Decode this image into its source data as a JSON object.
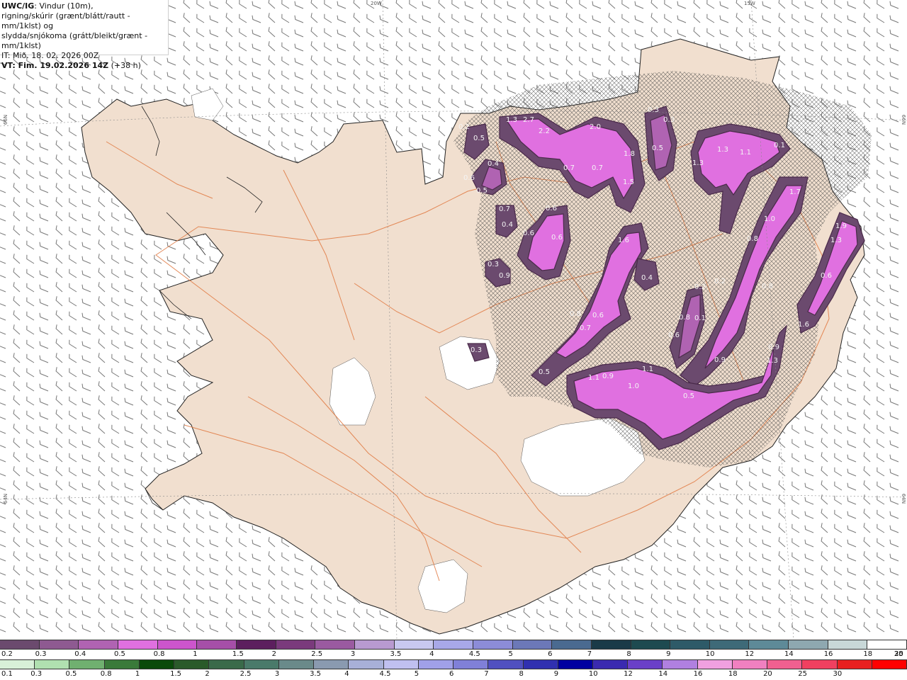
{
  "title": {
    "model": "UWC/IG",
    "line1": ": Vindur (10m),",
    "line2": "rigning/skúrir (grænt/blátt/rautt - mm/1klst) og",
    "line3": "slydda/snjókoma (grátt/bleikt/grænt - mm/1klst)",
    "it": "IT: Mið. 18. 02. 2026 00Z",
    "vt_bold": "VT: Fim. 19.02.2026 14Z",
    "vt_lead": " (+38 h)"
  },
  "grid_labels": {
    "lon_20w": "20W",
    "lon_15w": "15W",
    "lat_66n_left": "66N",
    "lat_66n_right": "66N",
    "lat_64n_left": "64N",
    "lat_64n_right": "64N"
  },
  "map_labels": [
    "1.3",
    "2.7",
    "2.2",
    "2.0",
    "0.3",
    "0.3",
    "0.2",
    "0.5",
    "1.8",
    "0.5",
    "1.3",
    "1.1",
    "0.1",
    "1.3",
    "0.7",
    "0.7",
    "1.5",
    "0.6",
    "1.7",
    "0.4",
    "0.5",
    "0.7",
    "0.6",
    "1.0",
    "1.9",
    "0.4",
    "0.6",
    "0.6",
    "1.6",
    "1.3",
    "0.8",
    "0.3",
    "0.9",
    "0.4",
    "0.2",
    "0.2",
    "0.8",
    "0.8",
    "0.6",
    "0.8",
    "0.6",
    "0.1",
    "0.7",
    "0.6",
    "1.6",
    "0.3",
    "0.9",
    "0.5",
    "1.1",
    "0.9",
    "1.1",
    "0.9",
    "1.3",
    "1.0",
    "0.5"
  ],
  "legend_snow": {
    "colors": [
      "#6b4a6e",
      "#8e5a91",
      "#b063b2",
      "#e070e0",
      "#cc55cc",
      "#a64fa8",
      "#5c1f5e",
      "#7a3a7c",
      "#9a5aa0",
      "#b89ad0",
      "#c8c8f0",
      "#a8a8e8",
      "#8c8cd8",
      "#6c78b8",
      "#4a6a90",
      "#1a3a48",
      "#1e4a50",
      "#2e5a68",
      "#3e6a78",
      "#5e8a98",
      "#8ea8b0",
      "#c8d8d8",
      "#ffffff"
    ],
    "labels": [
      "0.2",
      "0.3",
      "0.4",
      "0.5",
      "0.8",
      "1",
      "1.5",
      "2",
      "2.5",
      "3",
      "3.5",
      "4",
      "4.5",
      "5",
      "6",
      "7",
      "8",
      "9",
      "10",
      "12",
      "14",
      "16",
      "18",
      "20",
      "25",
      "30"
    ]
  },
  "legend_rain": {
    "colors": [
      "#d8f0d8",
      "#b0e0b0",
      "#70b070",
      "#3a7a3a",
      "#0a4a0a",
      "#2a5a2a",
      "#3a6a4a",
      "#4a7a6a",
      "#6a8a8a",
      "#8a9ab0",
      "#a8b0d8",
      "#c0c0f0",
      "#a0a0e8",
      "#8080d8",
      "#5050c0",
      "#3030b0",
      "#0000a0",
      "#3a2ab0",
      "#6a40c8",
      "#b080e0",
      "#f0a0e0",
      "#f080c0",
      "#f06090",
      "#f04060",
      "#e82020",
      "#ff0000"
    ],
    "labels": [
      "0.1",
      "0.3",
      "0.5",
      "0.8",
      "1",
      "1.5",
      "2",
      "2.5",
      "3",
      "3.5",
      "4",
      "4.5",
      "5",
      "6",
      "7",
      "8",
      "9",
      "10",
      "12",
      "14",
      "16",
      "18",
      "20",
      "25",
      "30"
    ]
  }
}
